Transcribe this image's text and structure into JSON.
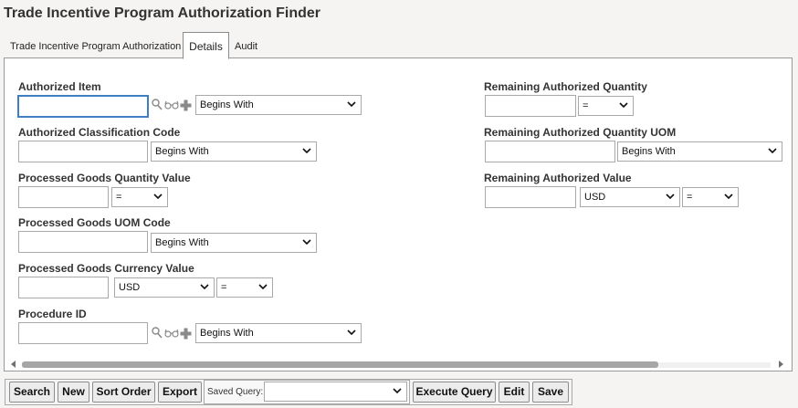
{
  "window": {
    "title": "Trade Incentive Program Authorization Finder"
  },
  "tabs": [
    {
      "label": "Trade Incentive Program Authorization"
    },
    {
      "label": "Details"
    },
    {
      "label": "Audit"
    }
  ],
  "fields": {
    "authorized_item": {
      "label": "Authorized Item",
      "value": "",
      "operator": "Begins With"
    },
    "authorized_classification_code": {
      "label": "Authorized Classification Code",
      "value": "",
      "operator": "Begins With"
    },
    "processed_goods_quantity_value": {
      "label": "Processed Goods Quantity Value",
      "value": "",
      "operator": "="
    },
    "processed_goods_uom_code": {
      "label": "Processed Goods UOM Code",
      "value": "",
      "operator": "Begins With"
    },
    "processed_goods_currency_value": {
      "label": "Processed Goods Currency Value",
      "value": "",
      "currency": "USD",
      "operator": "="
    },
    "procedure_id": {
      "label": "Procedure ID",
      "value": "",
      "operator": "Begins With"
    },
    "remaining_authorized_quantity": {
      "label": "Remaining Authorized Quantity",
      "value": "",
      "operator": "="
    },
    "remaining_authorized_quantity_uom": {
      "label": "Remaining Authorized Quantity UOM",
      "value": "",
      "operator": "Begins With"
    },
    "remaining_authorized_value": {
      "label": "Remaining Authorized Value",
      "value": "",
      "currency": "USD",
      "operator": "="
    }
  },
  "icons": {
    "lookup": "magnifier-icon",
    "glasses": "glasses-icon",
    "add": "plus-icon",
    "dropdown": "chevron-down-icon"
  },
  "toolbar": {
    "search": "Search",
    "new": "New",
    "sort_order": "Sort Order",
    "export": "Export",
    "saved_query_label": "Saved Query:",
    "saved_query_value": "",
    "execute_query": "Execute Query",
    "edit": "Edit",
    "save": "Save"
  },
  "colors": {
    "focus": "#3f7fc1",
    "background": "#f6f4f2",
    "panel": "#ffffff"
  }
}
